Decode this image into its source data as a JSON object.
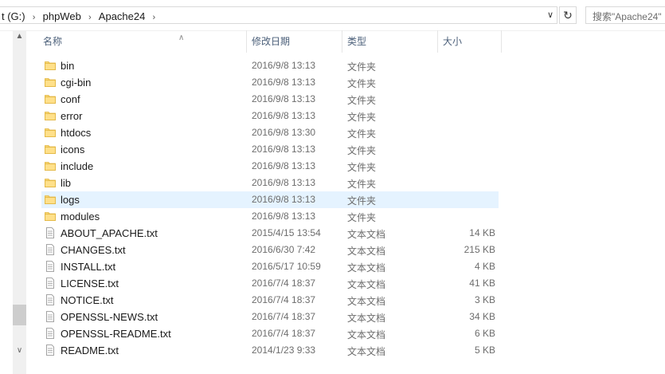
{
  "address": {
    "crumbs": [
      "t (G:)",
      "phpWeb",
      "Apache24"
    ],
    "search_placeholder": "搜索\"Apache24\""
  },
  "columns": {
    "name": "名称",
    "date": "修改日期",
    "type": "类型",
    "size": "大小"
  },
  "selected_index": 8,
  "files": [
    {
      "name": "bin",
      "date": "2016/9/8 13:13",
      "type": "文件夹",
      "size": "",
      "icon": "folder-icon"
    },
    {
      "name": "cgi-bin",
      "date": "2016/9/8 13:13",
      "type": "文件夹",
      "size": "",
      "icon": "folder-icon"
    },
    {
      "name": "conf",
      "date": "2016/9/8 13:13",
      "type": "文件夹",
      "size": "",
      "icon": "folder-icon"
    },
    {
      "name": "error",
      "date": "2016/9/8 13:13",
      "type": "文件夹",
      "size": "",
      "icon": "folder-icon"
    },
    {
      "name": "htdocs",
      "date": "2016/9/8 13:30",
      "type": "文件夹",
      "size": "",
      "icon": "folder-icon"
    },
    {
      "name": "icons",
      "date": "2016/9/8 13:13",
      "type": "文件夹",
      "size": "",
      "icon": "folder-icon"
    },
    {
      "name": "include",
      "date": "2016/9/8 13:13",
      "type": "文件夹",
      "size": "",
      "icon": "folder-icon"
    },
    {
      "name": "lib",
      "date": "2016/9/8 13:13",
      "type": "文件夹",
      "size": "",
      "icon": "folder-icon"
    },
    {
      "name": "logs",
      "date": "2016/9/8 13:13",
      "type": "文件夹",
      "size": "",
      "icon": "folder-icon"
    },
    {
      "name": "modules",
      "date": "2016/9/8 13:13",
      "type": "文件夹",
      "size": "",
      "icon": "folder-icon"
    },
    {
      "name": "ABOUT_APACHE.txt",
      "date": "2015/4/15 13:54",
      "type": "文本文档",
      "size": "14 KB",
      "icon": "text-file-icon"
    },
    {
      "name": "CHANGES.txt",
      "date": "2016/6/30 7:42",
      "type": "文本文档",
      "size": "215 KB",
      "icon": "text-file-icon"
    },
    {
      "name": "INSTALL.txt",
      "date": "2016/5/17 10:59",
      "type": "文本文档",
      "size": "4 KB",
      "icon": "text-file-icon"
    },
    {
      "name": "LICENSE.txt",
      "date": "2016/7/4 18:37",
      "type": "文本文档",
      "size": "41 KB",
      "icon": "text-file-icon"
    },
    {
      "name": "NOTICE.txt",
      "date": "2016/7/4 18:37",
      "type": "文本文档",
      "size": "3 KB",
      "icon": "text-file-icon"
    },
    {
      "name": "OPENSSL-NEWS.txt",
      "date": "2016/7/4 18:37",
      "type": "文本文档",
      "size": "34 KB",
      "icon": "text-file-icon"
    },
    {
      "name": "OPENSSL-README.txt",
      "date": "2016/7/4 18:37",
      "type": "文本文档",
      "size": "6 KB",
      "icon": "text-file-icon"
    },
    {
      "name": "README.txt",
      "date": "2014/1/23 9:33",
      "type": "文本文档",
      "size": "5 KB",
      "icon": "text-file-icon"
    }
  ]
}
